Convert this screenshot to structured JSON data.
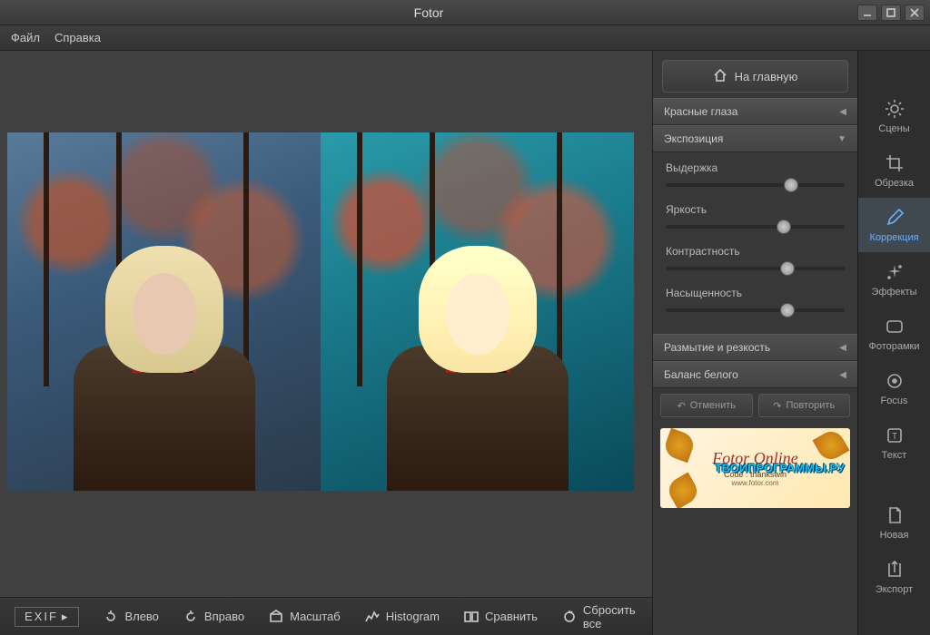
{
  "window": {
    "title": "Fotor"
  },
  "menu": {
    "file": "Файл",
    "help": "Справка"
  },
  "home_button": "На главную",
  "sections": {
    "red_eye": "Красные глаза",
    "exposure": "Экспозиция",
    "blur_sharp": "Размытие и резкость",
    "white_balance": "Баланс белого"
  },
  "sliders": {
    "exposure": {
      "label": "Выдержка",
      "value": 70
    },
    "brightness": {
      "label": "Яркость",
      "value": 66
    },
    "contrast": {
      "label": "Контрастность",
      "value": 68
    },
    "saturation": {
      "label": "Насыщенность",
      "value": 68
    }
  },
  "undo": "Отменить",
  "redo": "Повторить",
  "promo": {
    "title": "Fotor Online",
    "code": "Code : thankswin",
    "url": "www.fotor.com"
  },
  "watermark": "ТВОИПРОГРАММЫ.РУ",
  "tools": {
    "scenes": "Сцены",
    "crop": "Обрезка",
    "adjust": "Коррекция",
    "effects": "Эффекты",
    "frames": "Фоторамки",
    "focus": "Focus",
    "text": "Текст",
    "new": "Новая",
    "export": "Экспорт"
  },
  "bottom": {
    "exif": "EXIF",
    "rotate_left": "Влево",
    "rotate_right": "Вправо",
    "zoom": "Масштаб",
    "histogram": "Histogram",
    "compare": "Сравнить",
    "reset": "Сбросить все"
  }
}
